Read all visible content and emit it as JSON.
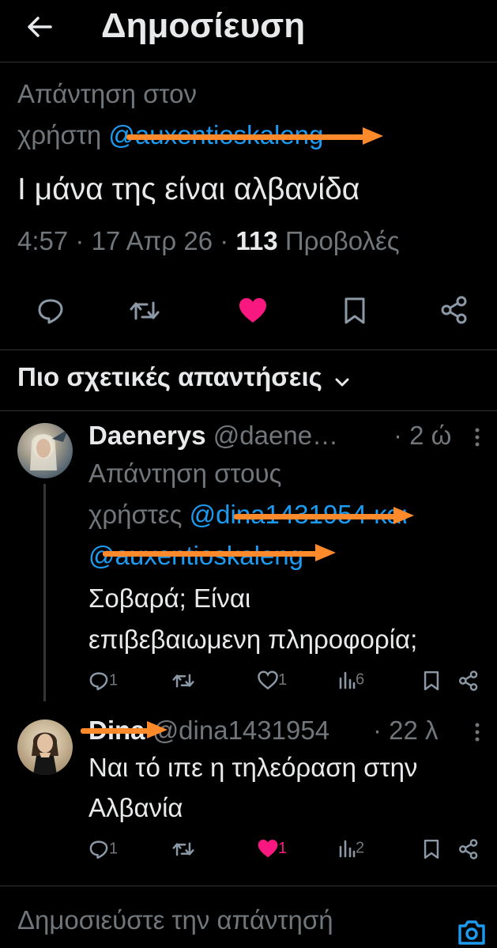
{
  "header": {
    "title": "Δημοσίευση",
    "back_icon": "arrow-left-icon"
  },
  "post": {
    "reply_to_prefix_line1": "Απάντηση στον",
    "reply_to_prefix_line2": "χρήστη",
    "reply_to_handle": "@auxentioskaleng",
    "text": "Ι  μάνα της είναι αλβανίδα",
    "time": "4:57",
    "date": "17 Απρ 26",
    "views_count": "113",
    "views_label": "Προβολές",
    "actions": [
      "reply-icon",
      "retweet-icon",
      "like-icon-filled",
      "bookmark-icon",
      "share-icon"
    ],
    "liked_color": "#f91880"
  },
  "sort": {
    "label": "Πιο σχετικές απαντήσεις",
    "icon": "chevron-down-icon"
  },
  "replies": [
    {
      "name": "Daenerys",
      "handle": "@daene…",
      "time": "· 2 ώ",
      "reply_prefix_line1": "Απάντηση στους",
      "reply_prefix_line2": "χρήστες",
      "reply_handle_1": "@dina1431954",
      "reply_and": "και",
      "reply_handle_2": "@auxentioskaleng",
      "text_line1": "Σοβαρά; Είναι",
      "text_line2": "επιβεβαιωμενη πληροφορία;",
      "reply_count": "1",
      "like_count": "1",
      "view_count": "6"
    },
    {
      "name": "Dina",
      "handle": "@dina1431954",
      "time": "· 22 λ",
      "text_line1": "Ναι τό ιπε η τηλεόραση στην",
      "text_line2": "Αλβανία",
      "reply_count": "1",
      "like_count": "1",
      "view_count": "2"
    }
  ],
  "composer": {
    "placeholder": "Δημοσιεύστε την απάντησή",
    "icon": "camera-icon"
  },
  "accent": "#1d9bf0",
  "annotation_color": "#ff8a2b"
}
